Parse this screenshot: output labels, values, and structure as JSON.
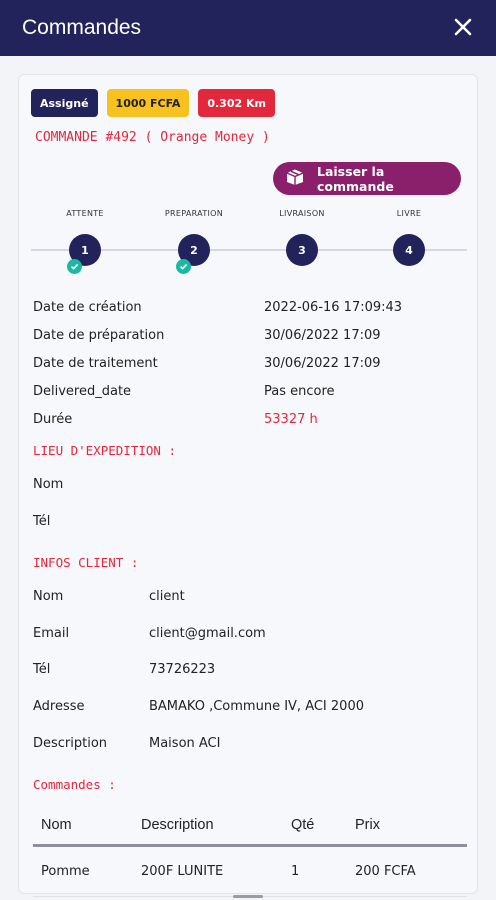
{
  "appbar": {
    "title": "Commandes",
    "close_icon": "close-icon"
  },
  "badges": {
    "status": "Assigné",
    "price": "1000 FCFA",
    "distance": "0.302 Km"
  },
  "order_title": "COMMANDE #492 ( Orange Money )",
  "leave_button": {
    "label": "Laisser la commande",
    "icon": "package-icon"
  },
  "steps": [
    {
      "label": "ATTENTE",
      "number": "1",
      "done": true
    },
    {
      "label": "PREPARATION",
      "number": "2",
      "done": true
    },
    {
      "label": "LIVRAISON",
      "number": "3",
      "done": false
    },
    {
      "label": "LIVRE",
      "number": "4",
      "done": false
    }
  ],
  "details": [
    {
      "key": "Date de création",
      "value": "2022-06-16 17:09:43"
    },
    {
      "key": "Date de préparation",
      "value": "30/06/2022 17:09"
    },
    {
      "key": "Date de traitement",
      "value": "30/06/2022 17:09"
    },
    {
      "key": "Delivered_date",
      "value": "Pas encore"
    },
    {
      "key": "Durée",
      "value": "53327 h"
    }
  ],
  "expedition": {
    "title": "LIEU D'EXPEDITION :",
    "nom_label": "Nom",
    "tel_label": "Tél"
  },
  "client": {
    "title": "INFOS CLIENT :",
    "rows": [
      {
        "key": "Nom",
        "value": "client"
      },
      {
        "key": "Email",
        "value": "client@gmail.com"
      },
      {
        "key": "Tél",
        "value": "73726223"
      },
      {
        "key": "Adresse",
        "value": "BAMAKO ,Commune IV, ACI 2000"
      },
      {
        "key": "Description",
        "value": "Maison ACI"
      }
    ]
  },
  "commandes": {
    "title": "Commandes :",
    "headers": [
      "Nom",
      "Description",
      "Qté",
      "Prix"
    ],
    "rows": [
      [
        "Pomme",
        "200F LUNITE",
        "1",
        "200 FCFA"
      ]
    ]
  },
  "colors": {
    "primary": "#23235b",
    "red": "#e3283c",
    "yellow": "#f7c21f",
    "purple": "#8a1f6c",
    "teal": "#1bb8a3"
  }
}
